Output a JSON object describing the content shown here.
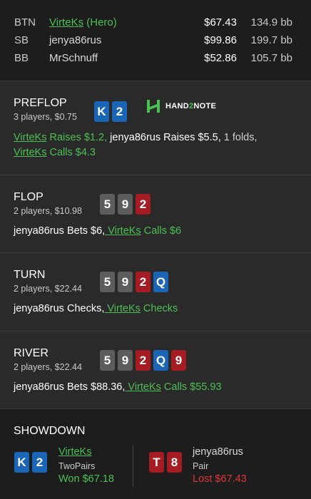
{
  "players": [
    {
      "pos": "BTN",
      "name": "VirteKs",
      "suffix": " (Hero)",
      "stack": "$67.43",
      "bb": "134.9 bb",
      "hero": true
    },
    {
      "pos": "SB",
      "name": "jenya86rus",
      "suffix": "",
      "stack": "$99.86",
      "bb": "199.7 bb",
      "hero": false
    },
    {
      "pos": "BB",
      "name": "MrSchnuff",
      "suffix": "",
      "stack": "$52.86",
      "bb": "105.7 bb",
      "hero": false
    }
  ],
  "logo": {
    "text_a": "HAND",
    "text_b": "2",
    "text_c": "NOTE"
  },
  "preflop": {
    "title": "PREFLOP",
    "sub": "3 players, $0.75",
    "cards": [
      {
        "rank": "K",
        "suit": "diamond"
      },
      {
        "rank": "2",
        "suit": "diamond"
      }
    ],
    "a1": "VirteKs",
    "a2": " Raises $1.2,",
    "a3": " jenya86rus",
    "a4": " Raises $5.5,",
    "a5": " 1 folds,",
    "a6": "VirteKs",
    "a7": " Calls $4.3"
  },
  "flop": {
    "title": "FLOP",
    "sub": "2 players, $10.98",
    "cards": [
      {
        "rank": "5",
        "suit": "spade"
      },
      {
        "rank": "9",
        "suit": "spade"
      },
      {
        "rank": "2",
        "suit": "heart"
      }
    ],
    "a1": "jenya86rus",
    "a2": " Bets $6,",
    "a3": " VirteKs",
    "a4": " Calls $6"
  },
  "turn": {
    "title": "TURN",
    "sub": "2 players, $22.44",
    "cards": [
      {
        "rank": "5",
        "suit": "spade"
      },
      {
        "rank": "9",
        "suit": "spade"
      },
      {
        "rank": "2",
        "suit": "heart"
      },
      {
        "rank": "Q",
        "suit": "diamond"
      }
    ],
    "a1": "jenya86rus",
    "a2": " Checks,",
    "a3": " VirteKs",
    "a4": " Checks"
  },
  "river": {
    "title": "RIVER",
    "sub": "2 players, $22.44",
    "cards": [
      {
        "rank": "5",
        "suit": "spade"
      },
      {
        "rank": "9",
        "suit": "spade"
      },
      {
        "rank": "2",
        "suit": "heart"
      },
      {
        "rank": "Q",
        "suit": "diamond"
      },
      {
        "rank": "9",
        "suit": "heart"
      }
    ],
    "a1": "jenya86rus",
    "a2": " Bets $88.36,",
    "a3": " VirteKs",
    "a4": " Calls $55.93"
  },
  "showdown": {
    "title": "SHOWDOWN",
    "p1": {
      "name": "VirteKs",
      "hand": "TwoPairs",
      "result": "Won $67.18",
      "cards": [
        {
          "rank": "K",
          "suit": "diamond"
        },
        {
          "rank": "2",
          "suit": "diamond"
        }
      ]
    },
    "p2": {
      "name": "jenya86rus",
      "hand": "Pair",
      "result": "Lost $67.43",
      "cards": [
        {
          "rank": "T",
          "suit": "heart"
        },
        {
          "rank": "8",
          "suit": "heart"
        }
      ]
    }
  },
  "colors": {
    "hero_green": "#4cc053",
    "loss_red": "#e0363b",
    "diamond": "#1b65b6",
    "heart": "#a51d22",
    "spade": "#5d5d5d"
  }
}
